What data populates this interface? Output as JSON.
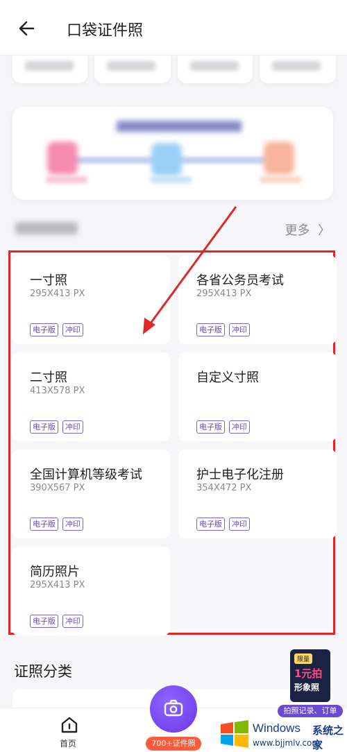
{
  "header": {
    "title": "口袋证件照"
  },
  "section": {
    "more_label": "更多"
  },
  "cards": [
    {
      "name": "一寸照",
      "size": "295X413 PX",
      "tags": [
        "电子版",
        "冲印"
      ]
    },
    {
      "name": "各省公务员考试",
      "size": "295X413 PX",
      "tags": [
        "电子版",
        "冲印"
      ]
    },
    {
      "name": "二寸照",
      "size": "413X578 PX",
      "tags": [
        "电子版",
        "冲印"
      ]
    },
    {
      "name": "自定义寸照",
      "size": "",
      "tags": [
        "电子版",
        "冲印"
      ]
    },
    {
      "name": "全国计算机等级考试",
      "size": "390X567 PX",
      "tags": [
        "电子版",
        "冲印"
      ]
    },
    {
      "name": "护士电子化注册",
      "size": "354X472 PX",
      "tags": [
        "电子版",
        "冲印"
      ]
    },
    {
      "name": "简历照片",
      "size": "295X413 PX",
      "tags": [
        "电子版",
        "冲印"
      ]
    }
  ],
  "category": {
    "title": "证照分类"
  },
  "promo": {
    "pill": "限量",
    "big": "1元拍",
    "sub": "形象照",
    "bar": "拍照记录、订单"
  },
  "tabbar": {
    "home_label": "首页",
    "camera_badge": "700+证件照"
  },
  "watermark": {
    "brand": "Windows",
    "site_cn": "系统之家",
    "url": "www.bjjmlv.com"
  },
  "colors": {
    "accent": "#7d62c9",
    "highlight_box": "#e02727",
    "camera": "#7a4cf2"
  }
}
